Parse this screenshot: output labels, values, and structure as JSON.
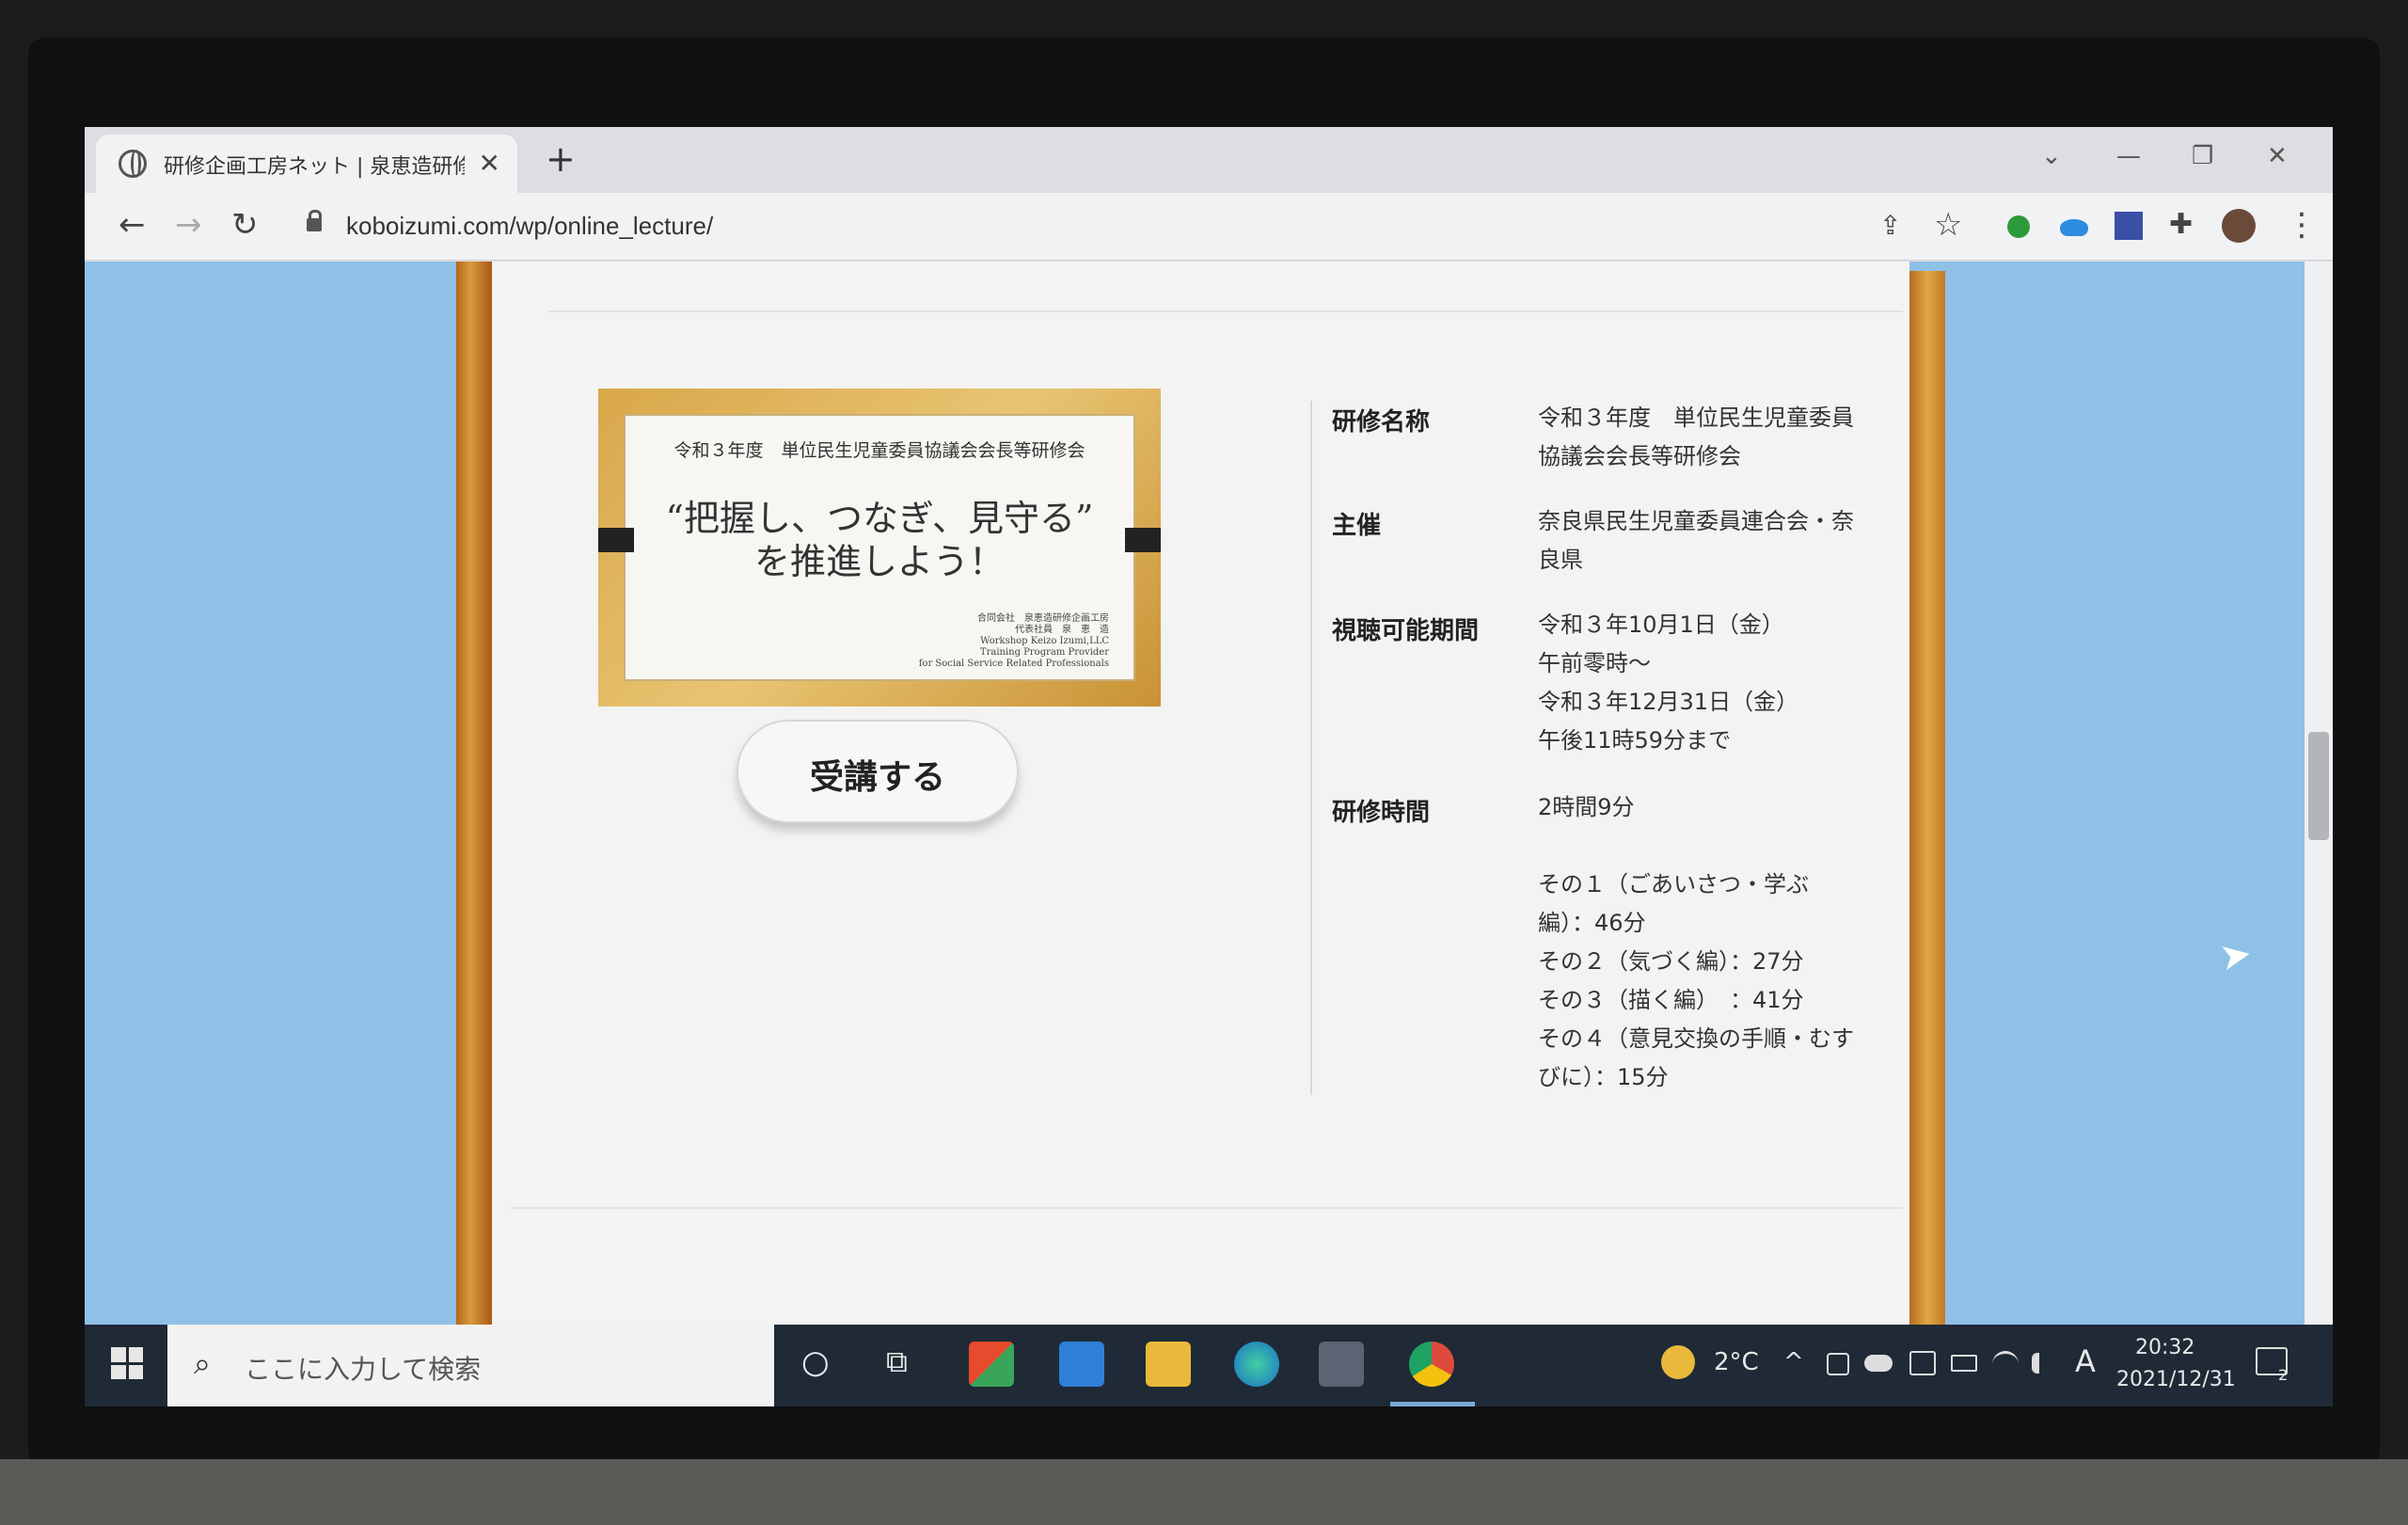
{
  "browser": {
    "tab_title": "研修企画工房ネット | 泉恵造研修企画",
    "tab_close": "✕",
    "new_tab": "+",
    "url": "koboizumi.com/wp/online_lecture/",
    "controls": {
      "chevron": "⌄",
      "minimize": "—",
      "restore": "❐",
      "close": "✕"
    },
    "nav": {
      "back": "←",
      "forward": "→",
      "reload": "↻",
      "share": "⇪",
      "star": "☆",
      "puzzle": "✚",
      "menu": "⋮"
    }
  },
  "page": {
    "thumbnail": {
      "top_line": "令和３年度　単位民生児童委員協議会会長等研修会",
      "main_line1": "“把握し、つなぎ、見守る”",
      "main_line2": "を推進しよう！",
      "sig_line1": "合同会社　泉恵造研修企画工房",
      "sig_line2": "代表社員　泉　恵　造",
      "sig_line3": "Workshop Keizo Izumi,LLC",
      "sig_line4": "Training Program Provider",
      "sig_line5": "for Social Service Related Professionals"
    },
    "enroll_button": "受講する",
    "details": {
      "name_label": "研修名称",
      "name_line1": "令和３年度　単位民生児童委員",
      "name_line2": "協議会会長等研修会",
      "host_label": "主催",
      "host_line1": "奈良県民生児童委員連合会・奈",
      "host_line2": "良県",
      "period_label": "視聴可能期間",
      "period_line1": "令和３年10月1日（金）",
      "period_line2": "午前零時～",
      "period_line3": "令和３年12月31日（金）",
      "period_line4": "午後11時59分まで",
      "duration_label": "研修時間",
      "duration_total": "2時間9分",
      "parts": [
        "その１（ごあいさつ・学ぶ",
        "編）：46分",
        "その２（気づく編）：27分",
        "その３（描く編）　：41分",
        "その４（意見交換の手順・むす",
        "びに）：15分"
      ]
    }
  },
  "taskbar": {
    "search_placeholder": "ここに入力して検索",
    "search_icon": "⌕",
    "cortana": "○",
    "taskview": "⧉",
    "weather": "2°C",
    "tray_caret": "^",
    "ime": "A",
    "time": "20:32",
    "date": "2021/12/31",
    "notifications_badge": "2"
  },
  "colors": {
    "page_bg": "#8fc0e6",
    "wood": "#c77b25",
    "paper": "#f3f3f1",
    "taskbar": "#1f2a36"
  }
}
